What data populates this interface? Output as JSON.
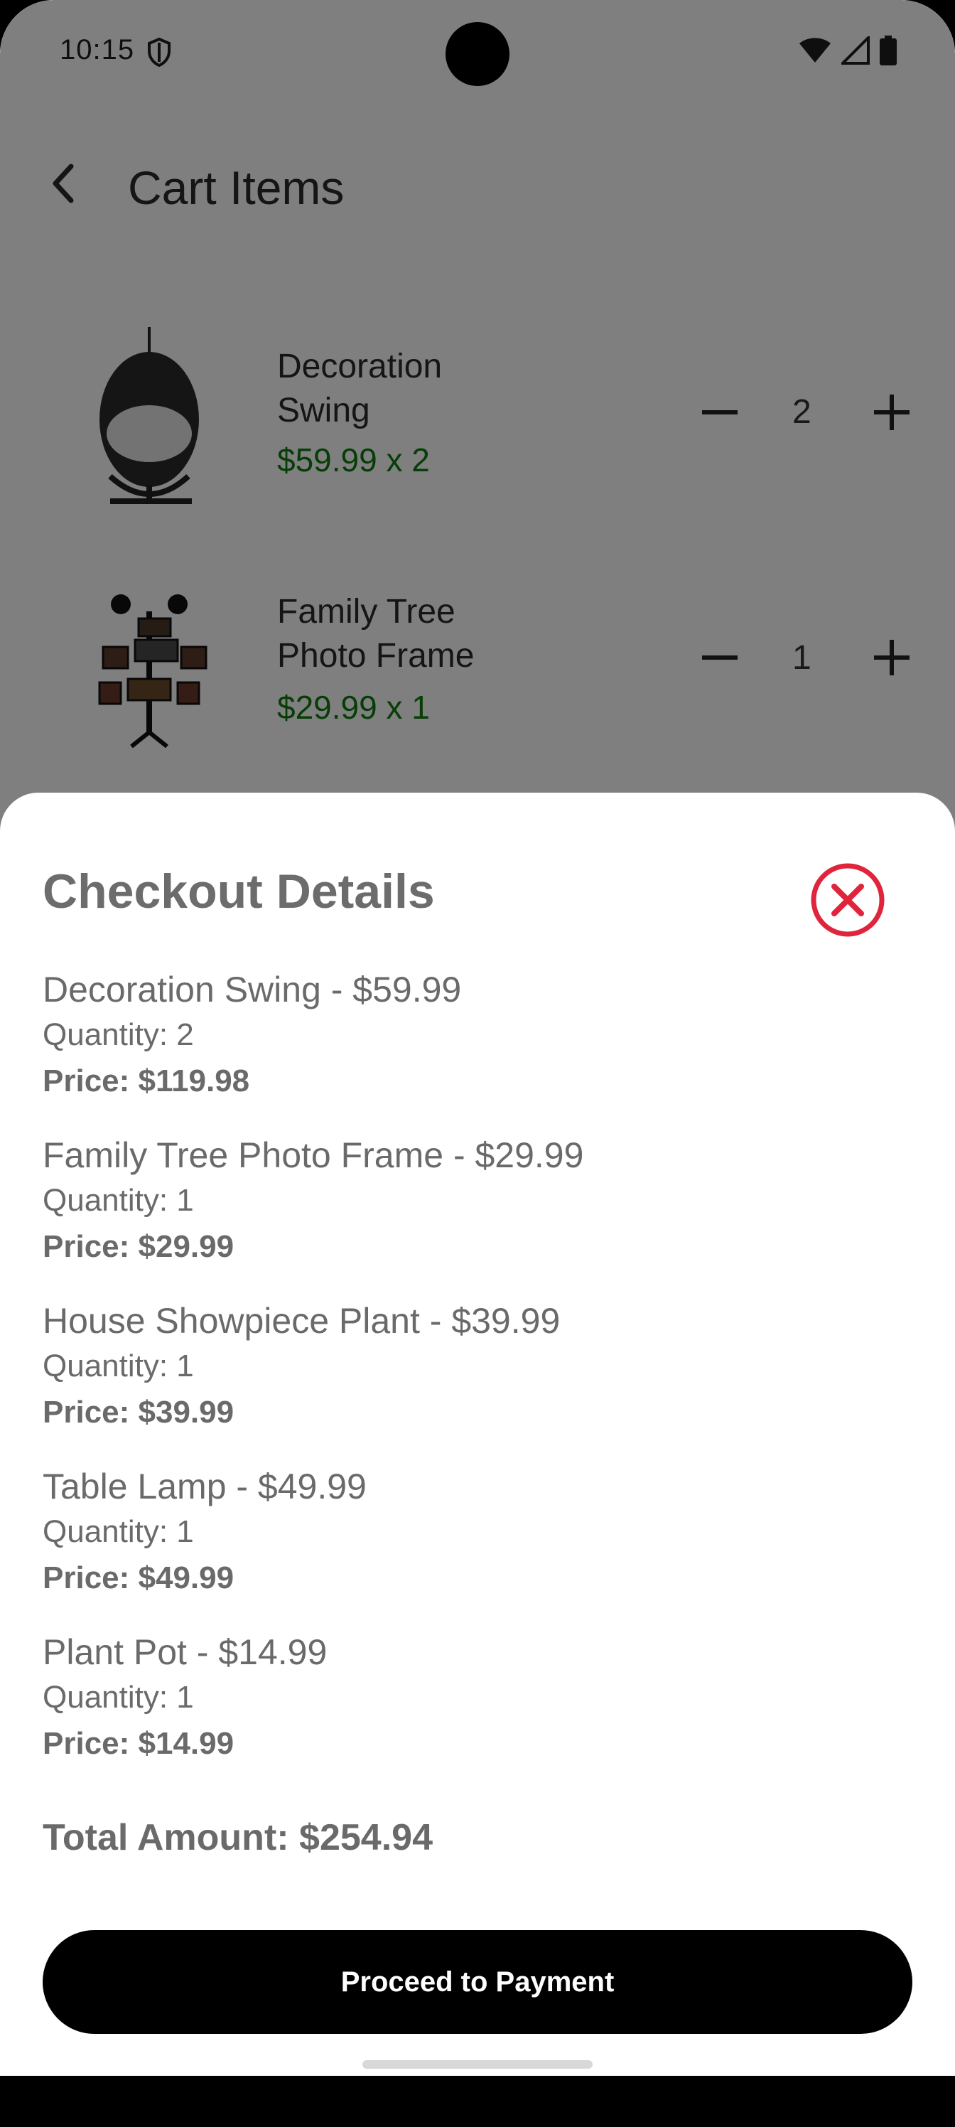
{
  "status_bar": {
    "time": "10:15",
    "icons": [
      "shield-icon",
      "wifi-icon",
      "cell-signal-icon",
      "battery-icon"
    ]
  },
  "app_bar": {
    "title": "Cart Items",
    "back_icon": "arrow-back-icon"
  },
  "cart_items": [
    {
      "name_line1": "Decoration",
      "name_line2": "Swing",
      "price_text": "$59.99 x 2",
      "quantity": "2"
    },
    {
      "name_line1": "Family Tree",
      "name_line2": "Photo Frame",
      "price_text": "$29.99 x 1",
      "quantity": "1"
    }
  ],
  "checkout": {
    "title": "Checkout Details",
    "close_icon": "close-circle-icon",
    "items": [
      {
        "title": "Decoration Swing - $59.99",
        "quantity": "Quantity: 2",
        "price": "Price: $119.98"
      },
      {
        "title": "Family Tree Photo Frame - $29.99",
        "quantity": "Quantity: 1",
        "price": "Price: $29.99"
      },
      {
        "title": "House Showpiece Plant - $39.99",
        "quantity": "Quantity: 1",
        "price": "Price: $39.99"
      },
      {
        "title": "Table Lamp - $49.99",
        "quantity": "Quantity: 1",
        "price": "Price: $49.99"
      },
      {
        "title": "Plant Pot - $14.99",
        "quantity": "Quantity: 1",
        "price": "Price: $14.99"
      }
    ],
    "total": "Total Amount: $254.94",
    "pay_button": "Proceed to Payment"
  },
  "colors": {
    "price_green": "#0f7d0f",
    "close_red": "#e0243b",
    "pay_button_bg": "#000000"
  }
}
